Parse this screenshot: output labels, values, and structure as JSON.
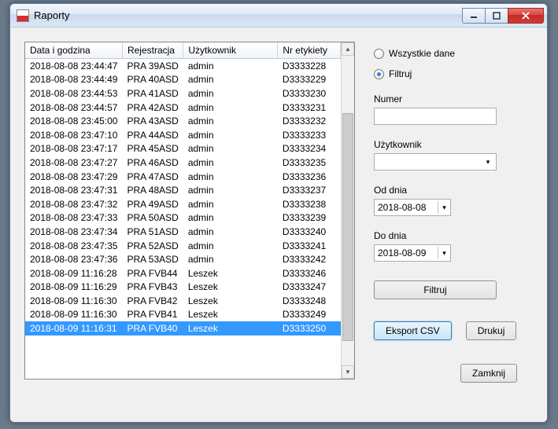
{
  "window": {
    "title": "Raporty"
  },
  "table": {
    "headers": {
      "date": "Data i godzina",
      "reg": "Rejestracja",
      "user": "Użytkownik",
      "label": "Nr etykiety"
    },
    "rows": [
      {
        "date": "2018-08-08 23:44:47",
        "reg": "PRA 39ASD",
        "user": "admin",
        "label": "D3333228"
      },
      {
        "date": "2018-08-08 23:44:49",
        "reg": "PRA 40ASD",
        "user": "admin",
        "label": "D3333229"
      },
      {
        "date": "2018-08-08 23:44:53",
        "reg": "PRA 41ASD",
        "user": "admin",
        "label": "D3333230"
      },
      {
        "date": "2018-08-08 23:44:57",
        "reg": "PRA 42ASD",
        "user": "admin",
        "label": "D3333231"
      },
      {
        "date": "2018-08-08 23:45:00",
        "reg": "PRA 43ASD",
        "user": "admin",
        "label": "D3333232"
      },
      {
        "date": "2018-08-08 23:47:10",
        "reg": "PRA 44ASD",
        "user": "admin",
        "label": "D3333233"
      },
      {
        "date": "2018-08-08 23:47:17",
        "reg": "PRA 45ASD",
        "user": "admin",
        "label": "D3333234"
      },
      {
        "date": "2018-08-08 23:47:27",
        "reg": "PRA 46ASD",
        "user": "admin",
        "label": "D3333235"
      },
      {
        "date": "2018-08-08 23:47:29",
        "reg": "PRA 47ASD",
        "user": "admin",
        "label": "D3333236"
      },
      {
        "date": "2018-08-08 23:47:31",
        "reg": "PRA 48ASD",
        "user": "admin",
        "label": "D3333237"
      },
      {
        "date": "2018-08-08 23:47:32",
        "reg": "PRA 49ASD",
        "user": "admin",
        "label": "D3333238"
      },
      {
        "date": "2018-08-08 23:47:33",
        "reg": "PRA 50ASD",
        "user": "admin",
        "label": "D3333239"
      },
      {
        "date": "2018-08-08 23:47:34",
        "reg": "PRA 51ASD",
        "user": "admin",
        "label": "D3333240"
      },
      {
        "date": "2018-08-08 23:47:35",
        "reg": "PRA 52ASD",
        "user": "admin",
        "label": "D3333241"
      },
      {
        "date": "2018-08-08 23:47:36",
        "reg": "PRA 53ASD",
        "user": "admin",
        "label": "D3333242"
      },
      {
        "date": "2018-08-09 11:16:28",
        "reg": "PRA FVB44",
        "user": "Leszek",
        "label": "D3333246"
      },
      {
        "date": "2018-08-09 11:16:29",
        "reg": "PRA FVB43",
        "user": "Leszek",
        "label": "D3333247"
      },
      {
        "date": "2018-08-09 11:16:30",
        "reg": "PRA FVB42",
        "user": "Leszek",
        "label": "D3333248"
      },
      {
        "date": "2018-08-09 11:16:30",
        "reg": "PRA FVB41",
        "user": "Leszek",
        "label": "D3333249"
      },
      {
        "date": "2018-08-09 11:16:31",
        "reg": "PRA FVB40",
        "user": "Leszek",
        "label": "D3333250",
        "selected": true
      }
    ]
  },
  "filters": {
    "radio_all": "Wszystkie dane",
    "radio_filter": "Filtruj",
    "radio_selected": "filter",
    "number_label": "Numer",
    "number_value": "",
    "user_label": "Użytkownik",
    "user_value": "",
    "from_label": "Od dnia",
    "from_value": "2018-08-08",
    "to_label": "Do dnia",
    "to_value": "2018-08-09",
    "filter_button": "Filtruj",
    "export_button": "Eksport CSV",
    "print_button": "Drukuj",
    "close_button": "Zamknij"
  }
}
